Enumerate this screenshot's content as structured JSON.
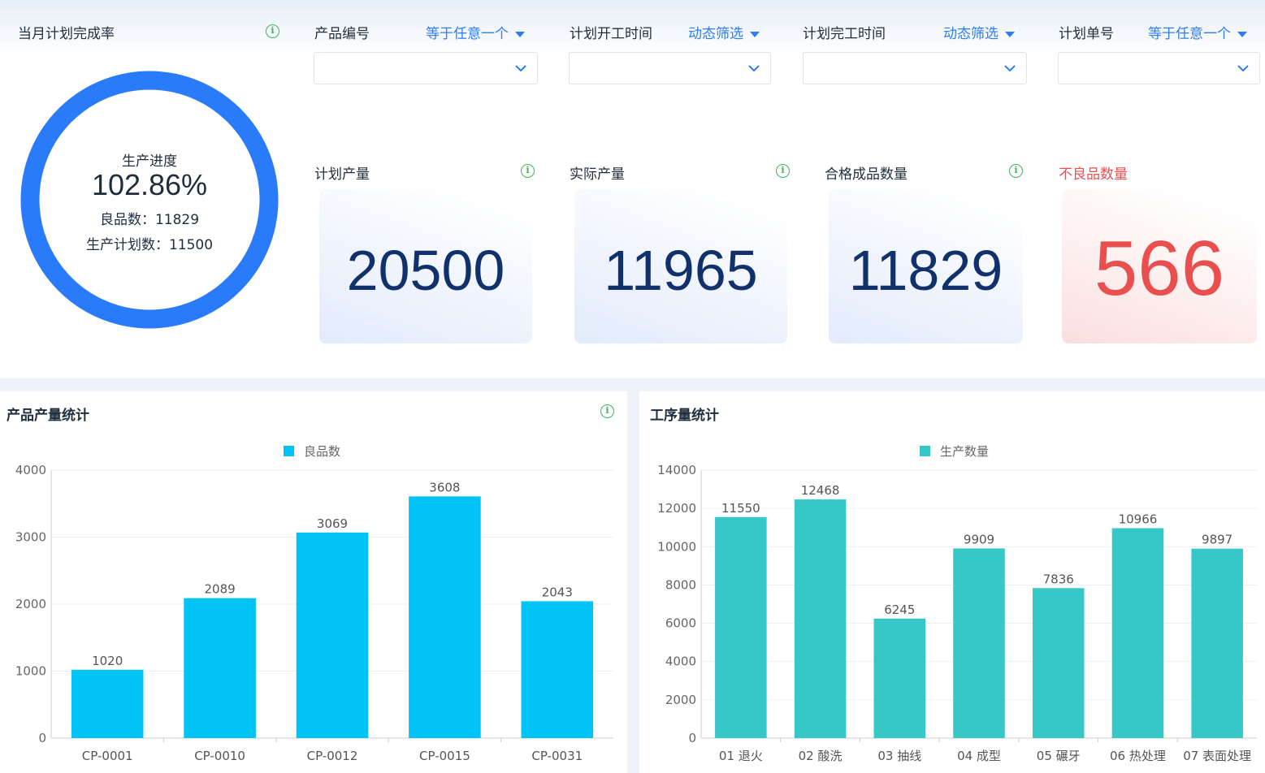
{
  "completion": {
    "title": "当月计划完成率",
    "center_title": "生产进度",
    "percent": "102.86%",
    "good_label": "良品数：",
    "good_value": "11829",
    "plan_label": "生产计划数：",
    "plan_value": "11500",
    "ring_color": "#2a7bfa"
  },
  "filters": [
    {
      "label": "产品编号",
      "mode": "等于任意一个"
    },
    {
      "label": "计划开工时间",
      "mode": "动态筛选"
    },
    {
      "label": "计划完工时间",
      "mode": "动态筛选"
    },
    {
      "label": "计划单号",
      "mode": "等于任意一个"
    }
  ],
  "kpis": [
    {
      "label": "计划产量",
      "value": "20500"
    },
    {
      "label": "实际产量",
      "value": "11965"
    },
    {
      "label": "合格成品数量",
      "value": "11829"
    },
    {
      "label": "不良品数量",
      "value": "566"
    }
  ],
  "product_panel": {
    "title": "产品产量统计"
  },
  "process_panel": {
    "title": "工序量统计"
  },
  "chart_data": [
    {
      "type": "bar",
      "categories": [
        "CP-0001",
        "CP-0010",
        "CP-0012",
        "CP-0015",
        "CP-0031"
      ],
      "series": [
        {
          "name": "良品数",
          "values": [
            1020,
            2089,
            3069,
            3608,
            2043
          ]
        }
      ],
      "ylim": [
        0,
        4000
      ],
      "yticks": [
        0,
        1000,
        2000,
        3000,
        4000
      ],
      "color": "#00c4f5",
      "grid": true,
      "legend": "top-center"
    },
    {
      "type": "bar",
      "categories": [
        "01 退火",
        "02 酸洗",
        "03 抽线",
        "04 成型",
        "05 碾牙",
        "06 热处理",
        "07 表面处理"
      ],
      "series": [
        {
          "name": "生产数量",
          "values": [
            11550,
            12468,
            6245,
            9909,
            7836,
            10966,
            9897
          ]
        }
      ],
      "ylim": [
        0,
        14000
      ],
      "yticks": [
        0,
        2000,
        4000,
        6000,
        8000,
        10000,
        12000,
        14000
      ],
      "color": "#36c7c7",
      "grid": true,
      "legend": "top-center"
    }
  ]
}
